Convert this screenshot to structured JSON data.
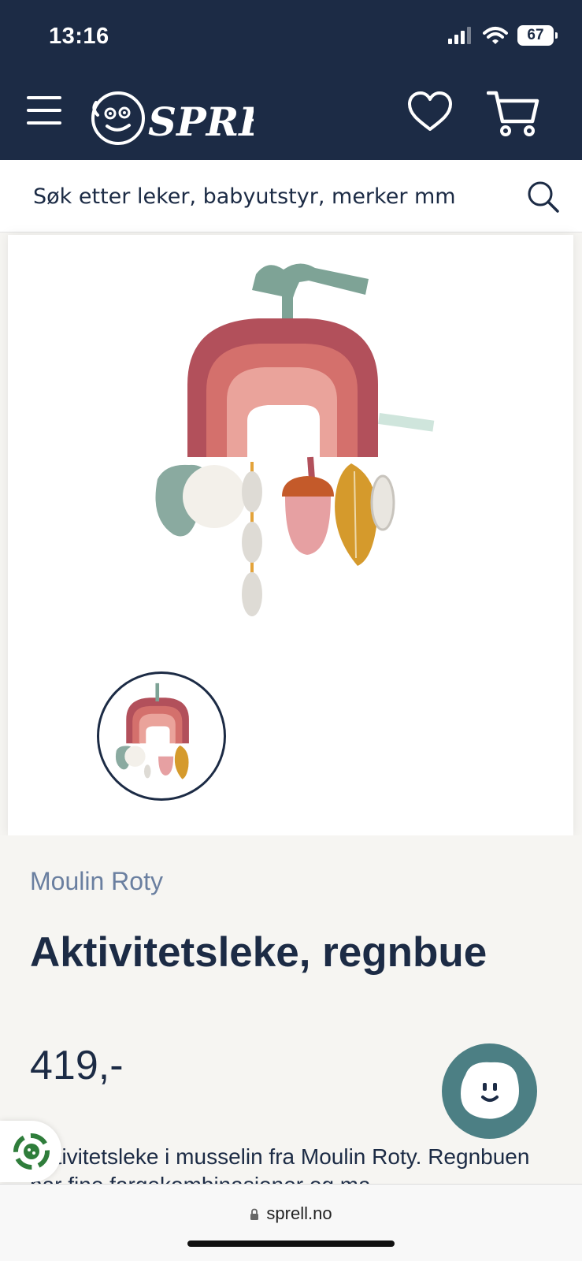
{
  "status_bar": {
    "time": "13:16",
    "battery": "67"
  },
  "header": {
    "logo_text": "SPRELL"
  },
  "search": {
    "placeholder": "Søk etter leker, babyutstyr, merker mm"
  },
  "gallery": {
    "image_count": 1
  },
  "product": {
    "brand": "Moulin Roty",
    "title": "Aktivitetsleke, regnbue",
    "price": "419,-",
    "description": "Aktivitetsleke i musselin fra Moulin Roty. Regnbuen har fine fargekombinasjoner og ma"
  },
  "browser": {
    "url": "sprell.no"
  },
  "colors": {
    "navy": "#1c2b45",
    "brand_text": "#6a7fa0",
    "chat": "#4c7f84",
    "background": "#f6f5f2"
  }
}
